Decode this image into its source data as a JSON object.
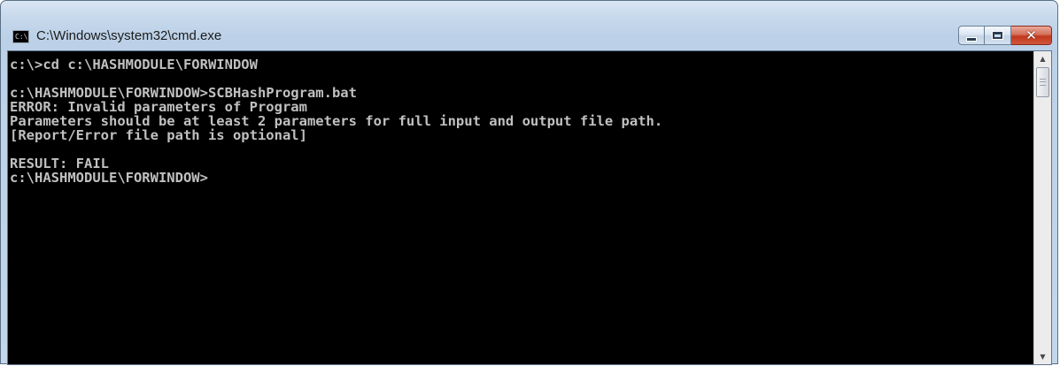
{
  "window": {
    "title": "C:\\Windows\\system32\\cmd.exe",
    "icon": "cmd-icon",
    "icon_text": "C:\\.",
    "controls": {
      "minimize_icon": "minimize-icon",
      "maximize_icon": "maximize-icon",
      "close_icon": "close-icon",
      "close_glyph": "✕"
    }
  },
  "console": {
    "lines": [
      "c:\\>cd c:\\HASHMODULE\\FORWINDOW",
      "",
      "c:\\HASHMODULE\\FORWINDOW>SCBHashProgram.bat",
      "ERROR: Invalid parameters of Program",
      "Parameters should be at least 2 parameters for full input and output file path.",
      "[Report/Error file path is optional]",
      "",
      "RESULT: FAIL",
      "c:\\HASHMODULE\\FORWINDOW>"
    ],
    "text_color": "#c0c0c0",
    "background_color": "#000000"
  },
  "scrollbar": {
    "up_glyph": "▲",
    "down_glyph": "▼"
  },
  "colors": {
    "titlebar": "#c6d8ec",
    "close_button": "#c2381c"
  }
}
